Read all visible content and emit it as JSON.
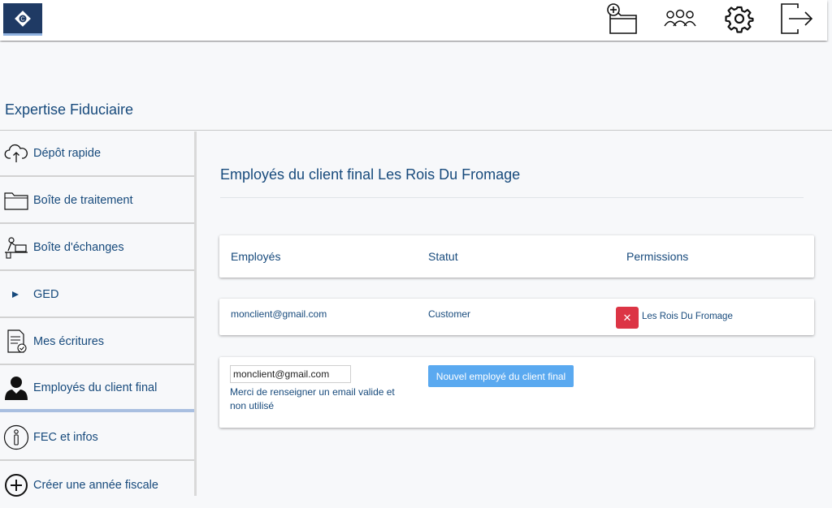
{
  "app": {
    "title": "Expertise Fiduciaire"
  },
  "topbar": {
    "icons": [
      "add-folder-icon",
      "users-icon",
      "gear-icon",
      "logout-icon"
    ]
  },
  "sidebar": {
    "items": [
      {
        "label": "Dépôt rapide",
        "icon": "cloud-upload-icon"
      },
      {
        "label": "Boîte de traitement",
        "icon": "folder-icon"
      },
      {
        "label": "Boîte d'échanges",
        "icon": "exchange-desk-icon"
      },
      {
        "label": "GED",
        "icon": "caret-right-icon"
      },
      {
        "label": "Mes écritures",
        "icon": "document-check-icon"
      },
      {
        "label": "Employés du client final",
        "icon": "user-icon",
        "active": true
      },
      {
        "label": "FEC et infos",
        "icon": "info-icon"
      },
      {
        "label": "Créer une année fiscale",
        "icon": "plus-circle-icon"
      }
    ]
  },
  "main": {
    "heading": "Employés du client final Les Rois Du Fromage",
    "table": {
      "headers": [
        "Employés",
        "Statut",
        "Permissions"
      ],
      "rows": [
        {
          "email": "monclient@gmail.com",
          "status": "Customer",
          "permission": "Les Rois Du Fromage",
          "remove_label": "✕"
        }
      ]
    },
    "new_employee": {
      "email_value": "monclient@gmail.com",
      "help_text": "Merci de renseigner un email valide et non utilisé",
      "button_label": "Nouvel employé du client final"
    }
  },
  "colors": {
    "primary_text": "#174a7c",
    "danger": "#dc3545",
    "button": "#5aa9f0",
    "logo_bg": "#1f3a64"
  }
}
